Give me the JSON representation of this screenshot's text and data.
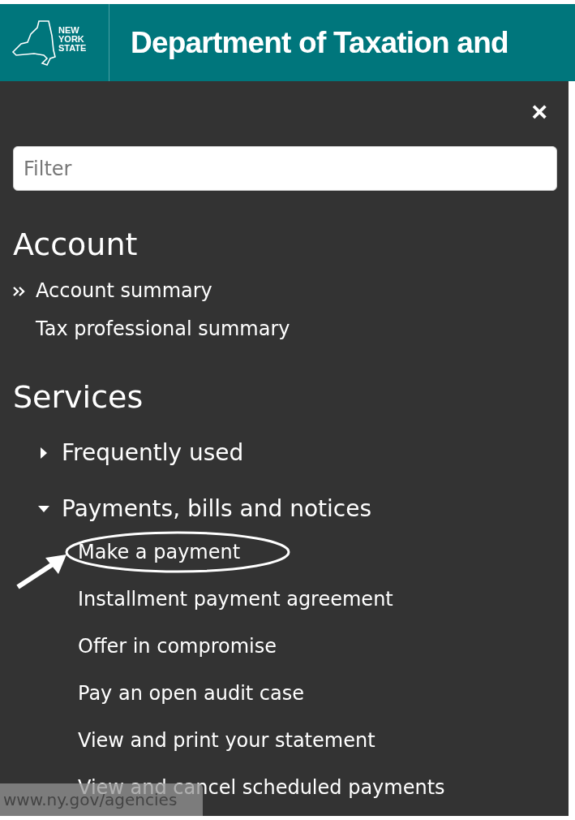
{
  "header": {
    "logo_lines": [
      "NEW",
      "YORK",
      "STATE"
    ],
    "title": "Department of Taxation and"
  },
  "menu": {
    "close": "×",
    "filter": {
      "placeholder": "Filter"
    },
    "sections": [
      {
        "heading": "Account",
        "items": [
          {
            "label": "Account summary",
            "selected": true
          },
          {
            "label": "Tax professional summary",
            "selected": false
          }
        ]
      },
      {
        "heading": "Services",
        "tree": [
          {
            "label": "Frequently used",
            "expanded": false
          },
          {
            "label": "Payments, bills and notices",
            "expanded": true,
            "children": [
              {
                "label": "Make a payment",
                "circled": true
              },
              {
                "label": "Installment payment agreement",
                "circled": false
              },
              {
                "label": "Offer in compromise",
                "circled": false
              },
              {
                "label": "Pay an open audit case",
                "circled": false
              },
              {
                "label": "View and print your statement",
                "circled": false
              },
              {
                "label": "View and cancel scheduled payments",
                "circled": false
              }
            ]
          }
        ]
      }
    ]
  },
  "status_url": "www.ny.gov/agencies"
}
